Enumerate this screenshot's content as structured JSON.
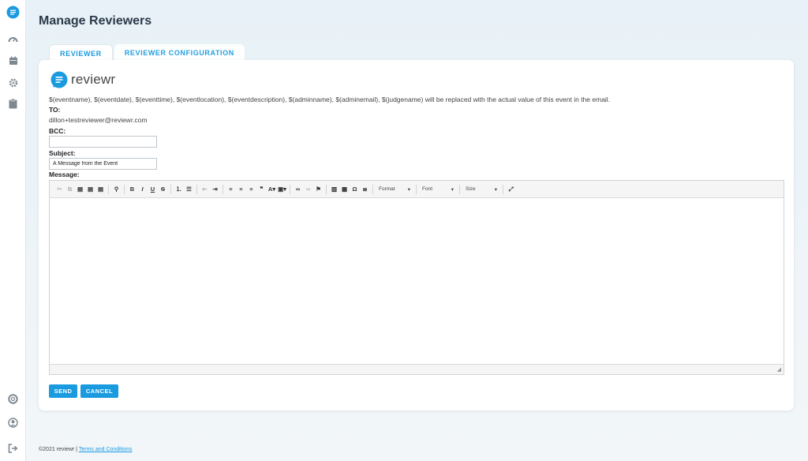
{
  "page": {
    "title": "Manage Reviewers"
  },
  "tabs": [
    {
      "label": "REVIEWER",
      "active": true
    },
    {
      "label": "REVIEWER CONFIGURATION",
      "active": false
    }
  ],
  "brand": {
    "name": "reviewr",
    "color": "#1a9be0"
  },
  "form": {
    "info_text": "$(eventname), $(eventdate), $(eventtime), $(eventlocation), $(eventdescription), $(adminname), $(adminemail), $(judgename) will be replaced with the actual value of this event in the email.",
    "to_label": "TO:",
    "to_value": "dillon+testreviewer@reviewr.com",
    "bcc_label": "BCC:",
    "bcc_value": "",
    "subject_label": "Subject:",
    "subject_value": "A Message from the Event",
    "message_label": "Message:"
  },
  "editor": {
    "toolbar_icons": [
      "cut-icon",
      "copy-icon",
      "paste-icon",
      "paste-text-icon",
      "paste-word-icon",
      "find-icon",
      "bold-icon",
      "italic-icon",
      "underline-icon",
      "strike-icon",
      "numbered-list-icon",
      "bullet-list-icon",
      "outdent-icon",
      "indent-icon",
      "align-left-icon",
      "align-center-icon",
      "align-right-icon",
      "blockquote-icon",
      "text-color-icon",
      "background-color-icon",
      "link-icon",
      "unlink-icon",
      "anchor-icon",
      "image-icon",
      "table-icon",
      "special-char-icon",
      "horizontal-rule-icon",
      "maximize-icon"
    ],
    "format_label": "Format",
    "font_label": "Font",
    "size_label": "Size"
  },
  "actions": {
    "send_label": "SEND",
    "cancel_label": "CANCEL"
  },
  "footer": {
    "copyright": "©2021 reviewr |",
    "terms_label": "Terms and Conditions"
  },
  "sidebar": {
    "icons": [
      "reviewr-logo-icon",
      "dashboard-icon",
      "calendar-icon",
      "settings-icon",
      "clipboard-icon",
      "help-icon",
      "account-icon",
      "logout-icon"
    ]
  }
}
